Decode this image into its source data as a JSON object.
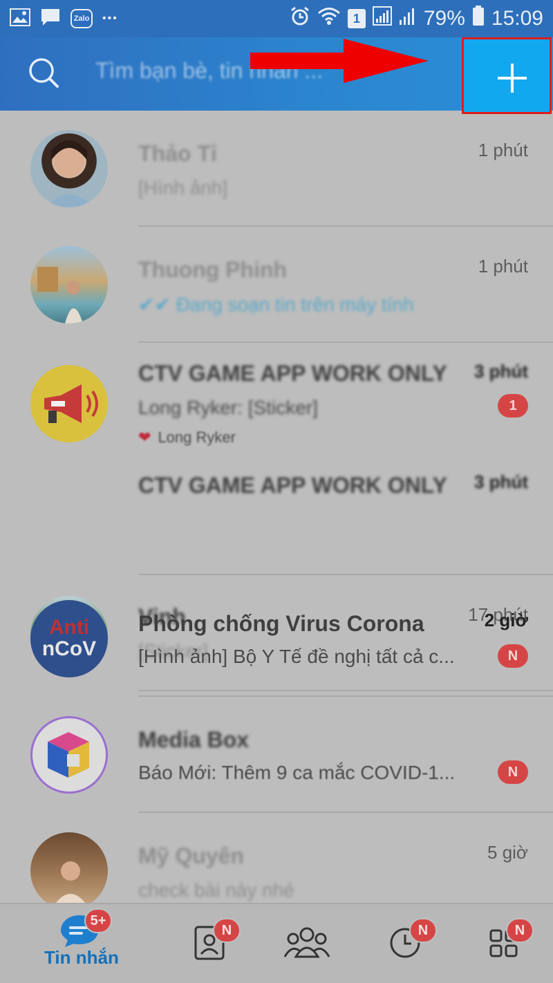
{
  "status_bar": {
    "battery_percent": "79%",
    "time": "15:09",
    "sim_number": "1",
    "app_icon_label": "Zalo",
    "more_dots": "•••"
  },
  "header": {
    "search_placeholder": "Tìm bạn bè, tin nhắn ...",
    "add_label": "+",
    "highlight_color": "#e21b1b",
    "arrow_color": "#ee0000"
  },
  "conversations": [
    {
      "name": "Thảo Tỉ",
      "preview": "[Hình ảnh]",
      "time": "1 phút"
    },
    {
      "name": "Thuong Phinh",
      "preview": "✔✔ Đang soạn tin trên máy tính",
      "time": "1 phút"
    },
    {
      "name": "CTV GAME APP WORK ONLY",
      "preview": "Long Ryker: [Sticker]",
      "time": "3 phút",
      "badge": "1",
      "reaction": "Long Ryker"
    },
    {
      "name": "Vinh",
      "preview": "[Sticker]",
      "time": "17 phút"
    },
    {
      "name": "Phòng chống Virus Corona",
      "preview": "[Hình ảnh] Bộ Y Tế đề nghị tất cả c...",
      "time": "2 giờ",
      "badge": "N",
      "avatar_text_top": "Anti",
      "avatar_text_bottom": "nCoV"
    },
    {
      "name": "Media Box",
      "preview": "Báo Mới: Thêm 9 ca mắc COVID-1...",
      "time": "",
      "badge": "N"
    },
    {
      "name": "Mỹ Quyên",
      "preview": "check bài này nhé",
      "time": "5 giờ"
    }
  ],
  "bottom_nav": {
    "messages_label": "Tin nhắn",
    "messages_badge": "5+",
    "contacts_badge": "N",
    "timeline_badge": "N",
    "more_badge": "N",
    "active_color": "#1470b8"
  }
}
